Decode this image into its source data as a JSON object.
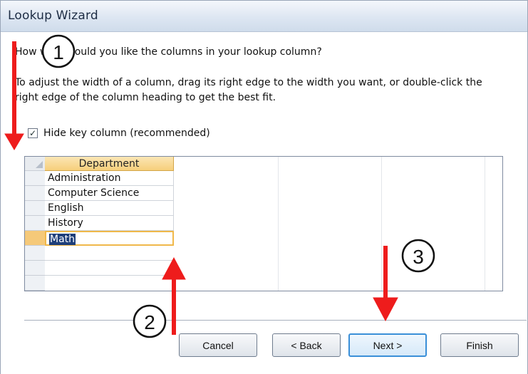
{
  "window": {
    "title": "Lookup Wizard"
  },
  "content": {
    "question": "How wide would you like the columns in your lookup column?",
    "instruction_line1": "To adjust the width of a column, drag its right edge to the width you want, or double-click the",
    "instruction_line2": "right edge of the column heading to get the best fit.",
    "checkbox": {
      "checked": true,
      "label": "Hide key column (recommended)"
    }
  },
  "grid": {
    "column_header": "Department",
    "rows": [
      "Administration",
      "Computer Science",
      "English",
      "History",
      "Math"
    ],
    "selected_row": "Math"
  },
  "buttons": {
    "cancel": "Cancel",
    "back": "< Back",
    "next": "Next >",
    "finish": "Finish"
  },
  "annotations": {
    "callouts": [
      "1",
      "2",
      "3"
    ],
    "arrow_color": "#ee1c1c"
  }
}
